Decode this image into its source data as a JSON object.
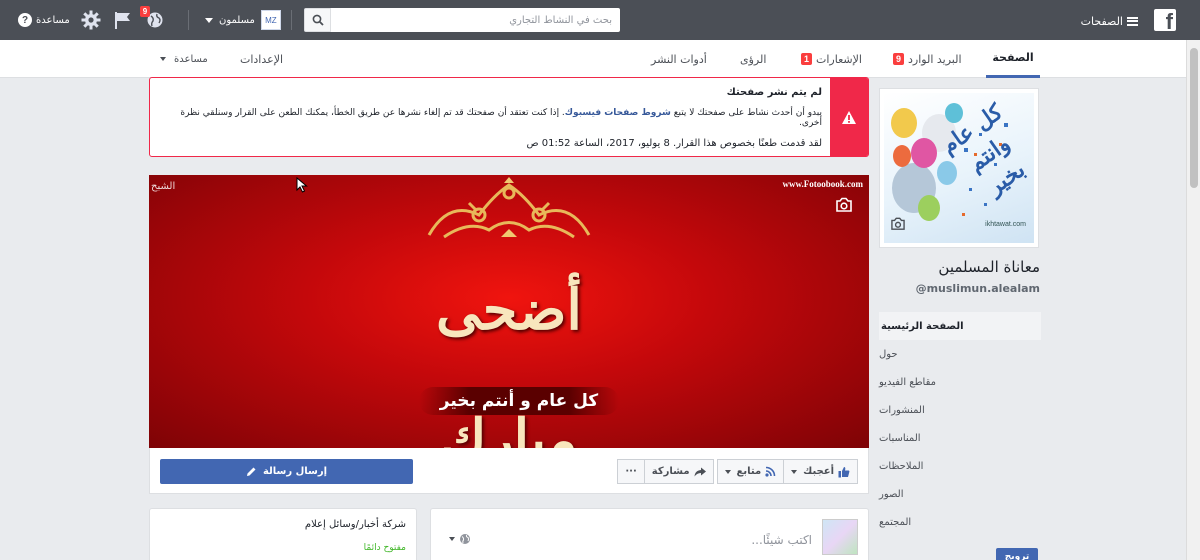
{
  "topbar": {
    "pages_label": "الصفحات",
    "search_placeholder": "بحث في النشاط التجاري",
    "user_name": "مسلمون",
    "user_initials": "MZ",
    "help_label": "مساعدة",
    "notifications_count": "9"
  },
  "tabs": {
    "page": "الصفحة",
    "inbox": "البريد الوارد",
    "inbox_count": "9",
    "notifications": "الإشعارات",
    "notifications_count": "1",
    "insights": "الرؤى",
    "publishing_tools": "أدوات النشر",
    "settings": "الإعدادات",
    "help": "مساعدة"
  },
  "alert": {
    "title": "لم يتم نشر صفحتك",
    "text_before": "يبدو أن أحدث نشاط على صفحتك لا يتبع ",
    "link": "شروط صفحات فيسبوك",
    "text_after": ". إذا كنت تعتقد أن صفحتك قد تم إلغاء نشرها عن طريق الخطأ، يمكنك الطعن على القرار وسنلقي نظرة أخرى.",
    "appeal_date": "لقد قدمت طعنًا بخصوص هذا القرار. 8 يوليو، 2017، الساعة 01:52 ص"
  },
  "cover": {
    "watermark": "www.Fotoobook.com",
    "watermark_left": "الشبح",
    "calligraphy": "أضحى مبارك",
    "tagline": "كل عام و أنتم بخير"
  },
  "actions": {
    "send_message": "إرسال رسالة",
    "like": "أعجبك",
    "follow": "متابع",
    "share": "مشاركة",
    "more": "···"
  },
  "composer": {
    "placeholder": "اكتب شيئًا..."
  },
  "about_card": {
    "category": "شركة أخبار/وسائل إعلام",
    "status": "مفتوح دائمًا"
  },
  "sidebar": {
    "page_name": "معاناة المسلمين",
    "handle": "@muslimun.alealam",
    "items": [
      {
        "label": "الصفحة الرئيسية"
      },
      {
        "label": "حول"
      },
      {
        "label": "مقاطع الفيديو"
      },
      {
        "label": "المنشورات"
      },
      {
        "label": "المناسبات"
      },
      {
        "label": "الملاحظات"
      },
      {
        "label": "الصور"
      },
      {
        "label": "المجتمع"
      }
    ],
    "promote_label": "ترويج"
  },
  "profile_pic": {
    "caption": "كل عام وانتم بخير",
    "site": "ikhtawat.com"
  },
  "colors": {
    "topbar": "#4b4f56",
    "accent": "#4267b2",
    "alert": "#f02849",
    "cover_red": "#d10a0d"
  }
}
